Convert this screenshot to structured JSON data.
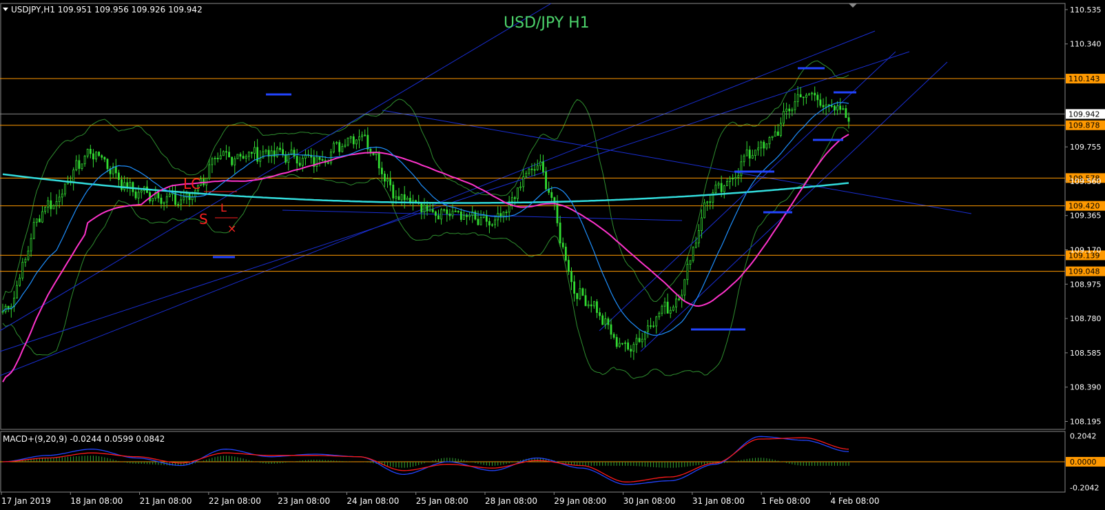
{
  "header": {
    "symbol_info": "USDJPY,H1  109.951 109.956 109.926 109.942",
    "title": "USD/JPY  H1"
  },
  "colors": {
    "background": "#000000",
    "candles": "#33dd33",
    "ma_fast": "#1e90ff",
    "ma_mid": "#ff33cc",
    "ma_slow": "#33dddd",
    "bollinger": "#2f8f2f",
    "level_lines": "#ff9900",
    "channel_lines": "#1a2fd6",
    "markers": "#2244ff",
    "title_text": "#4cd36b",
    "trade_labels": "#ff2020",
    "macd_main": "#2244ff",
    "macd_signal": "#ff1a1a",
    "macd_hist": "#33aa33"
  },
  "chart_data": [
    {
      "type": "line",
      "title": "USD/JPY  H1",
      "x": [
        "17 Jan 2019",
        "18 Jan 08:00",
        "21 Jan 08:00",
        "22 Jan 08:00",
        "23 Jan 08:00",
        "24 Jan 08:00",
        "25 Jan 08:00",
        "28 Jan 08:00",
        "29 Jan 08:00",
        "30 Jan 08:00",
        "31 Jan 08:00",
        "1 Feb 08:00",
        "4 Feb 08:00"
      ],
      "ylim": [
        108.15,
        110.57
      ],
      "y_ticks": [
        "110.535",
        "110.340",
        "109.755",
        "109.560",
        "109.365",
        "109.170",
        "108.975",
        "108.780",
        "108.585",
        "108.390",
        "108.195"
      ],
      "series": [
        {
          "values": [
            108.82,
            109.42,
            109.72,
            109.5,
            109.45,
            109.7,
            109.72,
            109.68,
            109.82,
            109.45,
            109.38,
            109.32,
            109.64,
            108.9,
            108.62,
            108.85,
            109.5,
            109.75,
            110.05,
            109.94
          ]
        }
      ],
      "level_lines": [
        "110.143",
        "109.878",
        "109.578",
        "109.420",
        "109.139",
        "109.048"
      ],
      "current_price": "109.942",
      "trade_labels": [
        "LC",
        "S",
        "L",
        "×"
      ]
    },
    {
      "type": "line",
      "title": "MACD+(9,20,9) -0.0244 0.0599 0.0842",
      "ylim": [
        -0.24,
        0.24
      ],
      "y_ticks": [
        "0.2042",
        "0.0000",
        "-0.2042"
      ],
      "series": [
        {
          "values": [
            0.0,
            0.05,
            0.1,
            0.03,
            -0.03,
            0.1,
            0.04,
            0.06,
            0.04,
            -0.1,
            0.0,
            -0.07,
            0.03,
            -0.05,
            -0.18,
            -0.15,
            -0.02,
            0.2,
            0.17,
            0.08
          ]
        },
        {
          "values": [
            0.0,
            0.03,
            0.07,
            0.04,
            -0.01,
            0.07,
            0.05,
            0.05,
            0.04,
            -0.07,
            -0.02,
            -0.05,
            0.01,
            -0.03,
            -0.16,
            -0.12,
            -0.01,
            0.18,
            0.19,
            0.1
          ]
        }
      ]
    }
  ]
}
